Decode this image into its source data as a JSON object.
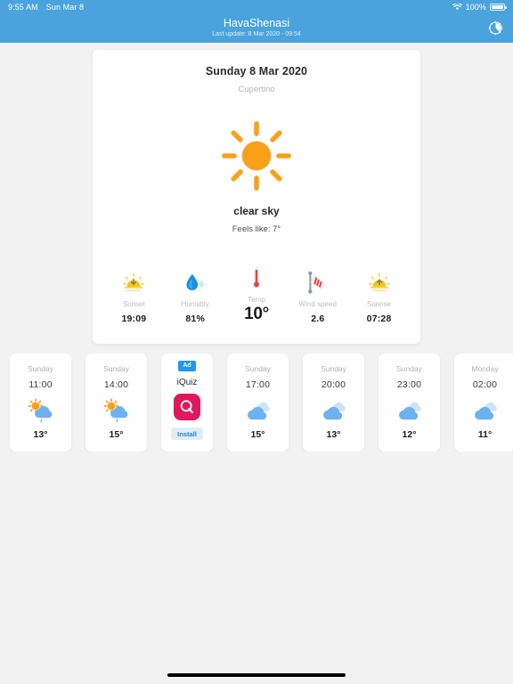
{
  "status_bar": {
    "time": "9:55 AM",
    "date": "Sun Mar 8",
    "battery_percent": "100%",
    "wifi_icon": "wifi-icon",
    "battery_icon": "battery-icon"
  },
  "nav": {
    "title": "HavaShenasi",
    "last_update": "Last update: 8 Mar 2020 - 09:54",
    "settings_icon": "gear-icon"
  },
  "current": {
    "date": "Sunday 8 Mar 2020",
    "city": "Cupertino",
    "condition": "clear sky",
    "condition_icon": "sun-icon",
    "feels_like": "Feels like:  7°",
    "stats": [
      {
        "label": "Sunset",
        "value": "19:09",
        "icon": "sunset-icon",
        "big": false
      },
      {
        "label": "Humidity",
        "value": "81%",
        "icon": "humidity-icon",
        "big": false
      },
      {
        "label": "Temp",
        "value": "10°",
        "icon": "thermometer-icon",
        "big": true
      },
      {
        "label": "Wind speed",
        "value": "2.6",
        "icon": "windsock-icon",
        "big": false
      },
      {
        "label": "Sunrise",
        "value": "07:28",
        "icon": "sunrise-icon",
        "big": false
      }
    ]
  },
  "forecast": [
    {
      "day": "Sunday",
      "time": "11:00",
      "temp": "13°",
      "icon": "sun-cloud-rain-icon"
    },
    {
      "day": "Sunday",
      "time": "14:00",
      "temp": "15°",
      "icon": "sun-cloud-rain-icon"
    },
    {
      "day": "Sunday",
      "time": "17:00",
      "temp": "15°",
      "icon": "broken-clouds-icon"
    },
    {
      "day": "Sunday",
      "time": "20:00",
      "temp": "13°",
      "icon": "broken-clouds-icon"
    },
    {
      "day": "Sunday",
      "time": "23:00",
      "temp": "12°",
      "icon": "broken-clouds-icon"
    },
    {
      "day": "Monday",
      "time": "02:00",
      "temp": "11°",
      "icon": "broken-clouds-icon"
    }
  ],
  "ad": {
    "badge": "Ad",
    "name": "iQuiz",
    "install_label": "Install",
    "app_icon": "iquiz-app-icon"
  },
  "colors": {
    "header_blue": "#4aa3dd",
    "page_background": "#f2f2f2",
    "card_white": "#ffffff",
    "sun_orange": "#f9a01b",
    "cloud_blue": "#6cb2f0",
    "ad_accent": "#e1175c",
    "install_blue": "#2a7fc4"
  }
}
